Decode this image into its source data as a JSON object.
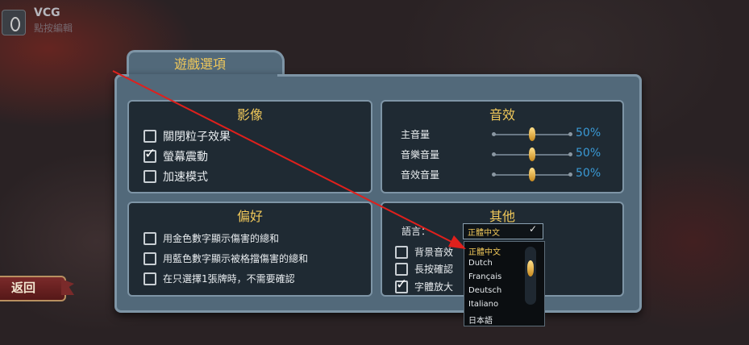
{
  "app": {
    "title": "VCG",
    "subtitle": "點按編輯"
  },
  "back_button": {
    "label": "返回"
  },
  "panel": {
    "title": "遊戲選項"
  },
  "sections": {
    "video": {
      "title": "影像",
      "options": [
        {
          "label": "關閉粒子效果",
          "checked": false
        },
        {
          "label": "螢幕震動",
          "checked": true
        },
        {
          "label": "加速模式",
          "checked": false
        }
      ]
    },
    "audio": {
      "title": "音效",
      "volumes": [
        {
          "label": "主音量",
          "value": "50%",
          "level": 0.5
        },
        {
          "label": "音樂音量",
          "value": "50%",
          "level": 0.5
        },
        {
          "label": "音效音量",
          "value": "50%",
          "level": 0.5
        }
      ]
    },
    "preferences": {
      "title": "偏好",
      "options": [
        {
          "label": "用金色數字顯示傷害的總和",
          "checked": false
        },
        {
          "label": "用藍色數字顯示被格擋傷害的總和",
          "checked": false
        },
        {
          "label": "在只選擇1張牌時，不需要確認",
          "checked": false
        }
      ]
    },
    "other": {
      "title": "其他",
      "language_label": "語言：",
      "language_value": "正體中文",
      "options": [
        {
          "label": "背景音效",
          "checked": false
        },
        {
          "label": "長按確認",
          "checked": false
        },
        {
          "label": "字體放大",
          "checked": true
        }
      ],
      "language_options": [
        "正體中文",
        "Dutch",
        "Français",
        "Deutsch",
        "Italiano",
        "日本語"
      ]
    }
  },
  "colors": {
    "accent": "#f0c85a",
    "value_blue": "#3a9ad6",
    "panel": "#52697a",
    "section": "#1f2a33",
    "annotation_arrow": "#e0201c"
  },
  "icons": [
    "diamond-logo-icon",
    "checkmark-icon",
    "slider-knob-icon"
  ]
}
